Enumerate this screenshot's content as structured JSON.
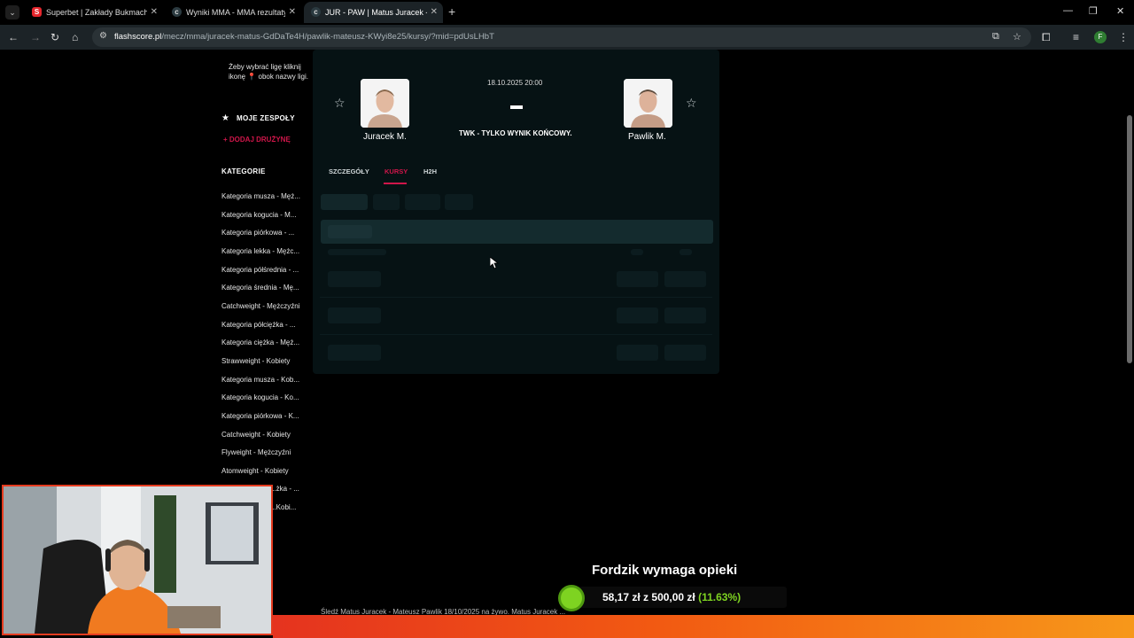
{
  "browser": {
    "tabs": [
      {
        "favicon": "S",
        "title": "Superbet | Zakłady Bukmacherskie",
        "active": false
      },
      {
        "favicon": "c",
        "title": "Wyniki MMA - MMA rezultaty",
        "active": false
      },
      {
        "favicon": "c",
        "title": "JUR - PAW | Matus Juracek - Mateusz Pawlik",
        "active": true
      }
    ],
    "url_host": "flashscore.pl",
    "url_path": "/mecz/mma/juracek-matus-GdDaTe4H/pawlik-mateusz-KWyi8e25/kursy/?mid=pdUsLHbT",
    "profile_initial": "F"
  },
  "sidebar": {
    "hint": "Żeby wybrać ligę kliknij ikonę 📍 obok nazwy ligi.",
    "my_teams": "MOJE ZESPOŁY",
    "add_team": "+ DODAJ DRUŻYNĘ",
    "categories_title": "KATEGORIE",
    "categories": [
      "Kategoria musza - Męż...",
      "Kategoria kogucia - M...",
      "Kategoria piórkowa - ...",
      "Kategoria lekka - Mężc...",
      "Kategoria półśrednia - ...",
      "Kategoria średnia - Mę...",
      "Catchweight - Mężczyźni",
      "Kategoria półciężka - ...",
      "Kategoria ciężka - Męż...",
      "Strawweight - Kobiety",
      "Kategoria musza - Kob...",
      "Kategoria kogucia - Ko...",
      "Kategoria piórkowa - K...",
      "Catchweight - Kobiety",
      "Flyweight - Mężczyźni",
      "Atomweight - Kobiety",
      "...żka - ...",
      "...Kobi..."
    ]
  },
  "match": {
    "date": "18.10.2025 20:00",
    "home": "Juracek M.",
    "away": "Pawlik M.",
    "score": "-",
    "status": "TWK - TYLKO WYNIK KOŃCOWY.",
    "tabs": [
      "SZCZEGÓŁY",
      "KURSY",
      "H2H"
    ],
    "active_tab": "KURSY"
  },
  "footer_text": "Śledź Matus Juracek - Mateusz Pawlik 18/10/2025 na żywo. Matus Juracek ...",
  "overlay": {
    "goal_title": "Fordzik wymaga opieki",
    "goal_amount": "58,17 zł",
    "goal_of": "z",
    "goal_target": "500,00 zł",
    "goal_percent": "(11.63%)",
    "goal_fraction": 0.1163
  },
  "colors": {
    "accent": "#d0164a",
    "panel": "#061214",
    "goal_green": "#7ed321"
  }
}
